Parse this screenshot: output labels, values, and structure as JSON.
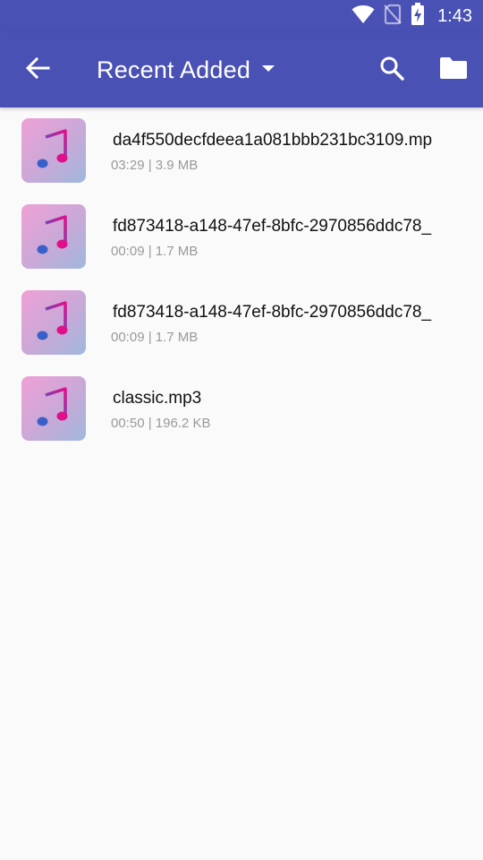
{
  "status_bar": {
    "time": "1:43",
    "icons": [
      "wifi-icon",
      "no-sim-icon",
      "battery-charging-icon"
    ]
  },
  "app_bar": {
    "title": "Recent Added",
    "icons": [
      "back-arrow-icon",
      "dropdown-arrow-icon",
      "search-icon",
      "folder-icon"
    ],
    "color": "#4a51b4"
  },
  "files": [
    {
      "name": "da4f550decfdeea1a081bbb231bc3109.mp",
      "meta": "03:29 | 3.9 MB",
      "icon": "music-note-icon"
    },
    {
      "name": "fd873418-a148-47ef-8bfc-2970856ddc78_",
      "meta": "00:09 | 1.7 MB",
      "icon": "music-note-icon"
    },
    {
      "name": "fd873418-a148-47ef-8bfc-2970856ddc78_",
      "meta": "00:09 | 1.7 MB",
      "icon": "music-note-icon"
    },
    {
      "name": "classic.mp3",
      "meta": "00:50 | 196.2 KB",
      "icon": "music-note-icon"
    }
  ]
}
